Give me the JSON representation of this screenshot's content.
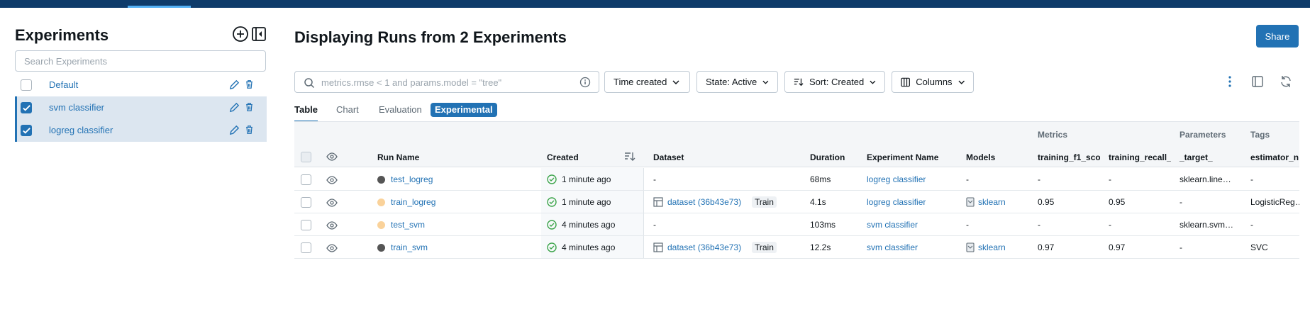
{
  "sidebar": {
    "title": "Experiments",
    "search_placeholder": "Search Experiments",
    "items": [
      {
        "label": "Default",
        "selected": false
      },
      {
        "label": "svm classifier",
        "selected": true
      },
      {
        "label": "logreg classifier",
        "selected": true
      }
    ]
  },
  "main": {
    "title": "Displaying Runs from 2 Experiments",
    "share_label": "Share",
    "search_placeholder": "metrics.rmse < 1 and params.model = \"tree\"",
    "filters": {
      "time": "Time created",
      "state": "State: Active",
      "sort": "Sort: Created",
      "columns": "Columns"
    },
    "tabs": [
      "Table",
      "Chart",
      "Evaluation"
    ],
    "badge": "Experimental",
    "groups": {
      "metrics": "Metrics",
      "parameters": "Parameters",
      "tags": "Tags"
    },
    "columns": {
      "run_name": "Run Name",
      "created": "Created",
      "dataset": "Dataset",
      "duration": "Duration",
      "experiment": "Experiment Name",
      "models": "Models",
      "f1": "training_f1_sco",
      "recall": "training_recall_",
      "target": "_target_",
      "estimator": "estimator_n"
    },
    "rows": [
      {
        "run": "test_logreg",
        "dot": "#555555",
        "created": "1 minute ago",
        "dataset": "-",
        "dataset_tag": "",
        "duration": "68ms",
        "experiment": "logreg classifier",
        "models": "-",
        "f1": "-",
        "recall": "-",
        "target": "sklearn.line…",
        "estimator": "-"
      },
      {
        "run": "train_logreg",
        "dot": "#fad29a",
        "created": "1 minute ago",
        "dataset": "dataset (36b43e73)",
        "dataset_tag": "Train",
        "duration": "4.1s",
        "experiment": "logreg classifier",
        "models": "sklearn",
        "f1": "0.95",
        "recall": "0.95",
        "target": "-",
        "estimator": "LogisticReg…"
      },
      {
        "run": "test_svm",
        "dot": "#fad29a",
        "created": "4 minutes ago",
        "dataset": "-",
        "dataset_tag": "",
        "duration": "103ms",
        "experiment": "svm classifier",
        "models": "-",
        "f1": "-",
        "recall": "-",
        "target": "sklearn.svm…",
        "estimator": "-"
      },
      {
        "run": "train_svm",
        "dot": "#555555",
        "created": "4 minutes ago",
        "dataset": "dataset (36b43e73)",
        "dataset_tag": "Train",
        "duration": "12.2s",
        "experiment": "svm classifier",
        "models": "sklearn",
        "f1": "0.97",
        "recall": "0.97",
        "target": "-",
        "estimator": "SVC"
      }
    ]
  },
  "colors": {
    "brand": "#2272b4",
    "topbar": "#0e3b6a",
    "selected_bg": "#dce6f0",
    "success": "#3ca44a"
  }
}
